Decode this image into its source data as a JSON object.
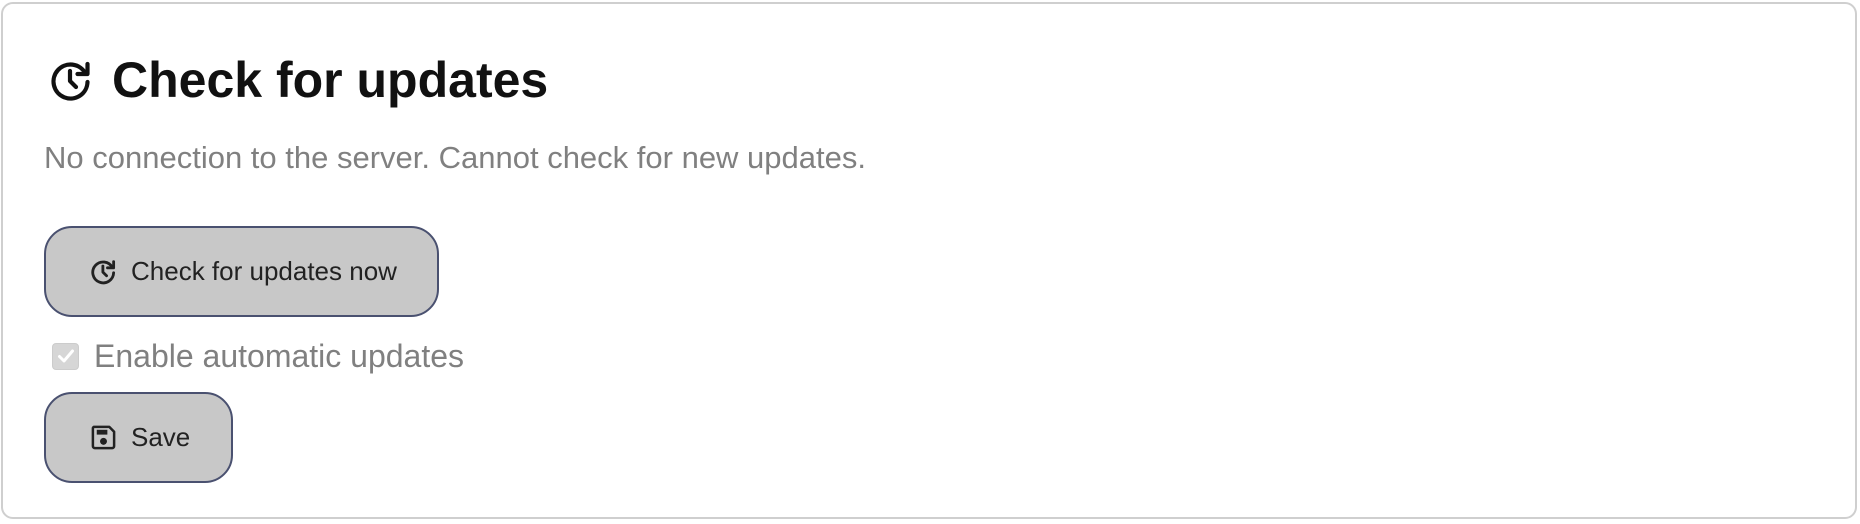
{
  "header": {
    "title": "Check for updates",
    "icon": "refresh-clock-icon"
  },
  "status": {
    "message": "No connection to the server. Cannot check for new updates."
  },
  "actions": {
    "check_now_label": "Check for updates now",
    "check_now_icon": "refresh-clock-icon",
    "save_label": "Save",
    "save_icon": "floppy-disk-icon"
  },
  "settings": {
    "auto_update_label": "Enable automatic updates",
    "auto_update_checked": true,
    "auto_update_disabled": true
  },
  "colors": {
    "button_bg": "#c8c8c8",
    "button_border": "#4a5170",
    "muted_text": "#808080",
    "card_border": "#cfcfcf"
  }
}
